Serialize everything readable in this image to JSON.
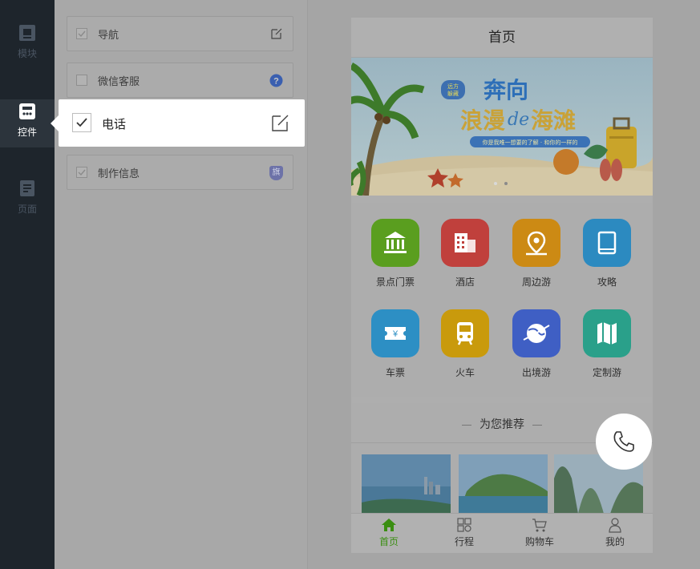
{
  "leftnav": {
    "items": [
      {
        "label": "模块",
        "icon": "module-icon",
        "active": false
      },
      {
        "label": "控件",
        "icon": "widget-icon",
        "active": true
      },
      {
        "label": "页面",
        "icon": "page-icon",
        "active": false
      }
    ]
  },
  "panel": {
    "cards": [
      {
        "label": "导航",
        "checked": true,
        "right_icon": "edit-icon"
      },
      {
        "label": "微信客服",
        "checked": false,
        "right_icon": "help-icon"
      },
      {
        "label": "制作信息",
        "checked": true,
        "right_icon": "flag-badge-icon",
        "badge_text": "旗"
      }
    ],
    "highlight": {
      "label": "电话",
      "checked": true,
      "right_icon": "edit-icon"
    }
  },
  "phone": {
    "title": "首页",
    "banner": {
      "badge_line1": "远方",
      "badge_line2": "躲藏",
      "title_line1": "奔向",
      "title_line2_a": "浪漫",
      "title_line2_b": "de",
      "title_line2_c": "海滩",
      "subtitle": "你是我唯一想要的了解 · 和你的一样的",
      "accent_color": "#2d7fd0"
    },
    "grid": [
      {
        "label": "景点门票",
        "icon": "bank-icon",
        "color": "#5a9e1f"
      },
      {
        "label": "酒店",
        "icon": "hotel-icon",
        "color": "#c0403c"
      },
      {
        "label": "周边游",
        "icon": "map-pin-icon",
        "color": "#cc8a14"
      },
      {
        "label": "攻略",
        "icon": "book-icon",
        "color": "#2c8ac0"
      },
      {
        "label": "车票",
        "icon": "ticket-icon",
        "color": "#2d8fc4"
      },
      {
        "label": "火车",
        "icon": "train-icon",
        "color": "#c99a0c"
      },
      {
        "label": "出境游",
        "icon": "globe-plane-icon",
        "color": "#3f5fc4"
      },
      {
        "label": "定制游",
        "icon": "map-fold-icon",
        "color": "#2aa08a"
      }
    ],
    "recommend_title": "为您推荐",
    "tabs": [
      {
        "label": "首页",
        "icon": "home-icon",
        "active": true
      },
      {
        "label": "行程",
        "icon": "grid-icon",
        "active": false
      },
      {
        "label": "购物车",
        "icon": "cart-icon",
        "active": false
      },
      {
        "label": "我的",
        "icon": "user-icon",
        "active": false
      }
    ]
  },
  "call_button": {
    "icon": "phone-icon"
  }
}
